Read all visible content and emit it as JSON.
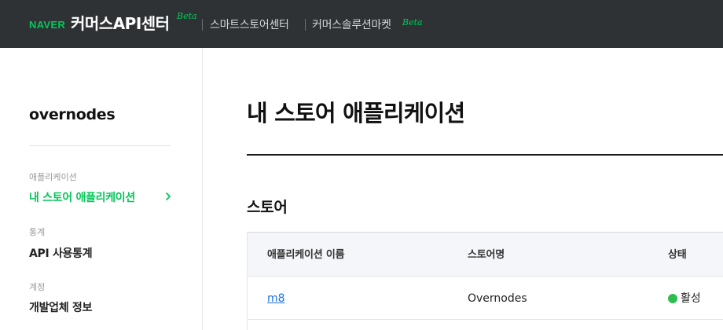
{
  "header": {
    "brand": "NAVER",
    "title": "커머스API센터",
    "title_badge": "Beta",
    "links": [
      {
        "label": "스마트스토어센터"
      },
      {
        "label": "커머스솔루션마켓",
        "badge": "Beta"
      }
    ]
  },
  "sidebar": {
    "account_name": "overnodes",
    "groups": [
      {
        "label": "애플리케이션",
        "item": "내 스토어 애플리케이션",
        "active": true
      },
      {
        "label": "통계",
        "item": "API 사용통계",
        "active": false
      },
      {
        "label": "계정",
        "item": "개발업체 정보",
        "active": false
      }
    ]
  },
  "main": {
    "page_title": "내 스토어 애플리케이션",
    "section_title": "스토어",
    "table": {
      "columns": [
        "애플리케이션 이름",
        "스토어명",
        "상태"
      ],
      "rows": [
        {
          "app_name": "m8",
          "store_name": "Overnodes",
          "status": "활성"
        }
      ]
    }
  },
  "colors": {
    "header_bg": "#2f3235",
    "brand_green": "#03c75a",
    "status_active": "#2dbe4e",
    "link_blue": "#1a73e8"
  },
  "icons": {
    "active_item_indicator": "chevron-right-icon",
    "status_indicator": "status-dot-icon"
  }
}
